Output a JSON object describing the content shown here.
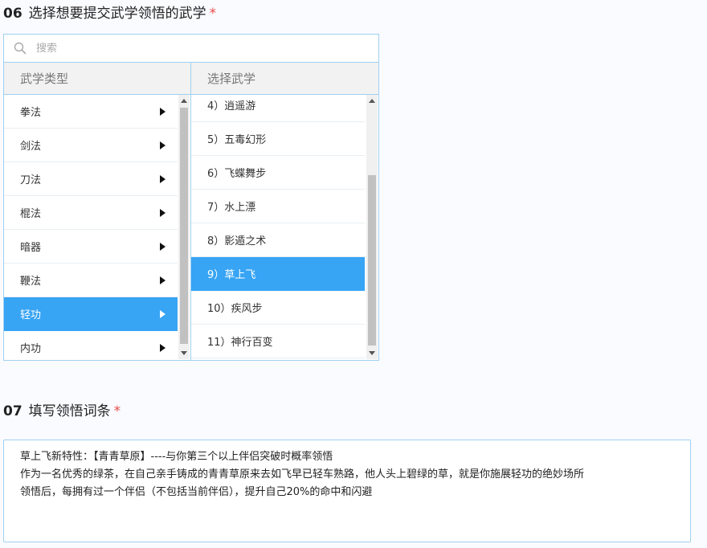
{
  "q06": {
    "number": "06",
    "title": "选择想要提交武学领悟的武学",
    "required_mark": "*"
  },
  "search": {
    "placeholder": "搜索",
    "icon": "search-icon"
  },
  "cascader": {
    "left_header": "武学类型",
    "right_header": "选择武学",
    "categories": [
      "拳法",
      "剑法",
      "刀法",
      "棍法",
      "暗器",
      "鞭法",
      "轻功",
      "内功"
    ],
    "selected_category": "轻功",
    "skills": [
      "4）逍遥游",
      "5）五毒幻形",
      "6）飞蝶舞步",
      "7）水上漂",
      "8）影遁之术",
      "9）草上飞",
      "10）疾风步",
      "11）神行百变"
    ],
    "selected_skill": "9）草上飞"
  },
  "colors": {
    "accent": "#38a4f4",
    "border": "#9fd0f0",
    "required": "#e64c4c"
  },
  "q07": {
    "number": "07",
    "title": "填写领悟词条",
    "required_mark": "*",
    "answer_lines": [
      "草上飞新特性：【青青草原】----与你第三个以上伴侣突破时概率领悟",
      "作为一名优秀的绿茶，在自己亲手铸成的青青草原来去如飞早已轻车熟路，他人头上碧绿的草，就是你施展轻功的绝妙场所",
      "领悟后，每拥有过一个伴侣（不包括当前伴侣），提升自己20%的命中和闪避"
    ]
  }
}
